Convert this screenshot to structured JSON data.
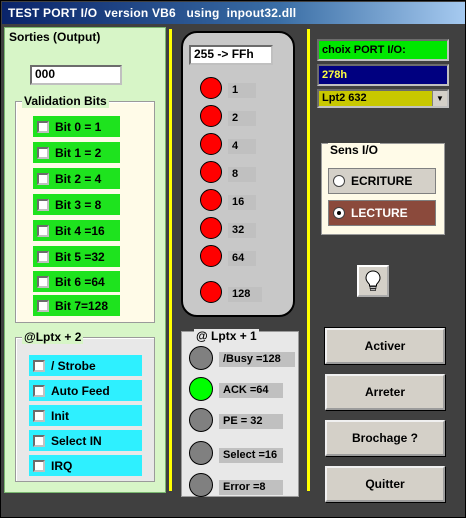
{
  "window": {
    "title": "TEST PORT I/O  version VB6   using  inpout32.dll"
  },
  "sorties": {
    "title": "Sorties (Output)",
    "value": "000"
  },
  "validation": {
    "title": "Validation Bits",
    "bits": [
      "Bit 0 = 1",
      "Bit 1 = 2",
      "Bit 2 = 4",
      "Bit 3 = 8",
      "Bit 4 =16",
      "Bit 5 =32",
      "Bit 6 =64",
      "Bit 7=128"
    ]
  },
  "lptx2": {
    "title": "@Lptx + 2",
    "items": [
      "/ Strobe",
      "Auto Feed",
      "Init",
      "Select IN",
      "IRQ"
    ]
  },
  "leds": {
    "display": "255 -> FFh",
    "labels": [
      "1",
      "2",
      "4",
      "8",
      "16",
      "32",
      "64",
      "128"
    ]
  },
  "lptx1": {
    "title": "@ Lptx + 1",
    "items": [
      "/Busy =128",
      "ACK =64",
      "PE  =  32",
      "Select =16",
      "Error =8"
    ],
    "states": [
      "grey",
      "green",
      "grey",
      "grey",
      "grey"
    ]
  },
  "port": {
    "choice_label": "choix PORT I/O:",
    "address": "278h",
    "selected": "Lpt2 632"
  },
  "sens": {
    "title": "Sens I/O",
    "ecriture": "ECRITURE",
    "lecture": "LECTURE"
  },
  "buttons": {
    "activer": "Activer",
    "arreter": "Arreter",
    "brochage": "Brochage ?",
    "quitter": "Quitter"
  }
}
